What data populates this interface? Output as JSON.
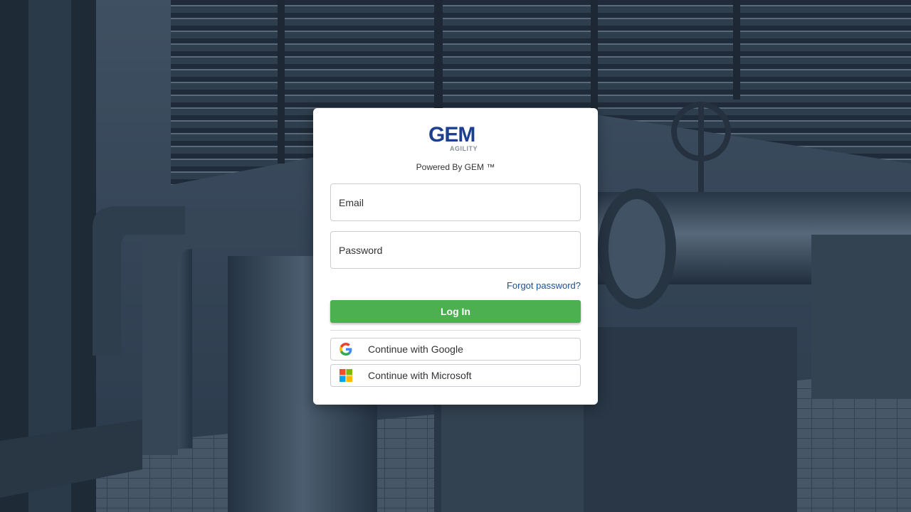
{
  "logo": {
    "main": "GEM",
    "sub": "AGILITY"
  },
  "powered_by": "Powered By GEM ™",
  "email": {
    "placeholder": "Email",
    "value": ""
  },
  "password": {
    "placeholder": "Password",
    "value": ""
  },
  "forgot_password_label": "Forgot password?",
  "login_label": "Log In",
  "sso": {
    "google_label": "Continue with Google",
    "microsoft_label": "Continue with Microsoft"
  },
  "colors": {
    "brand_blue": "#1d3f8f",
    "login_green": "#4caf50",
    "link": "#1d4f91"
  }
}
